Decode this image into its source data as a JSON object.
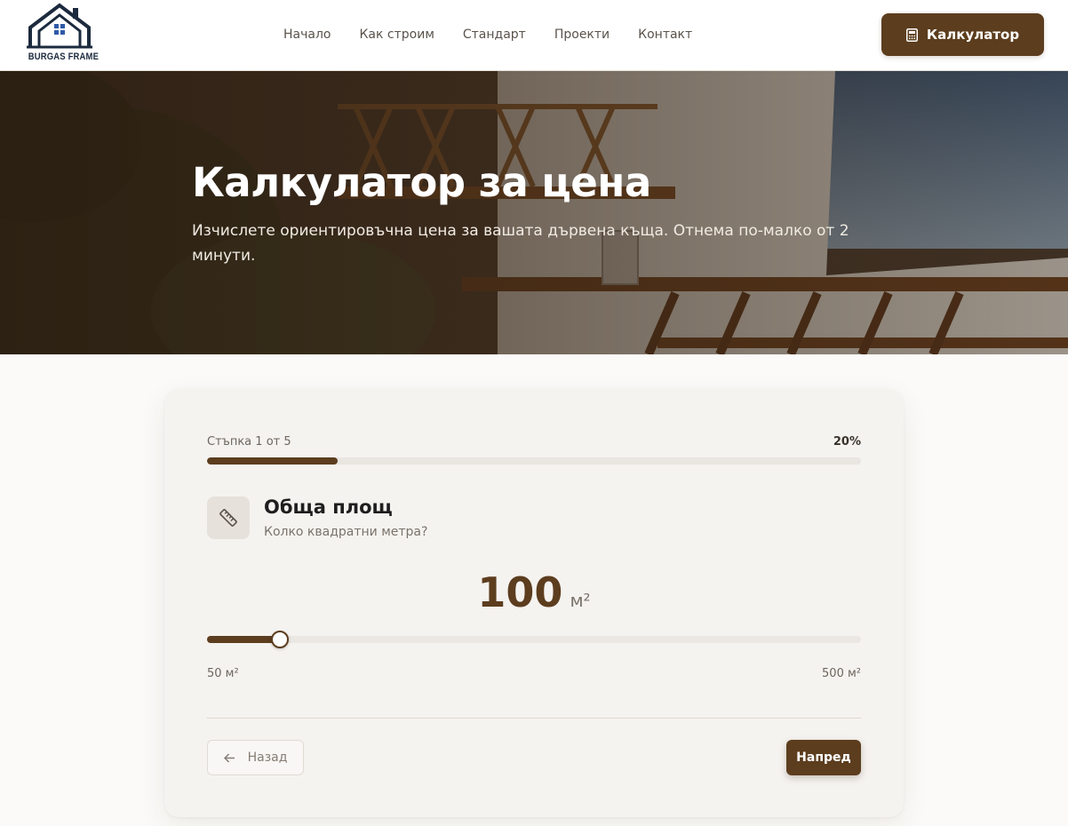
{
  "brand": {
    "name": "BURGAS FRAME"
  },
  "nav": {
    "items": [
      "Начало",
      "Как строим",
      "Стандарт",
      "Проекти",
      "Контакт"
    ]
  },
  "header_cta": {
    "label": "Калкулатор",
    "icon": "calculator-icon"
  },
  "hero": {
    "title": "Калкулатор за цена",
    "subtitle": "Изчислете ориентировъчна цена за вашата дървена къща. Отнема по-малко от 2 минути."
  },
  "wizard": {
    "step_label": "Стъпка 1 от 5",
    "percent_label": "20%",
    "progress_fraction": 0.2,
    "question": {
      "title": "Обща площ",
      "subtitle": "Колко квадратни метра?",
      "icon": "ruler-icon"
    },
    "area": {
      "value": "100",
      "unit": "м²",
      "value_num": 100,
      "min": 50,
      "max": 500,
      "min_label": "50 м²",
      "max_label": "500 м²"
    },
    "back_label": "Назад",
    "next_label": "Напред"
  },
  "colors": {
    "accent": "#5c3d1e",
    "card_bg": "#f5f3f0",
    "page_bg": "#fbfaf8"
  }
}
